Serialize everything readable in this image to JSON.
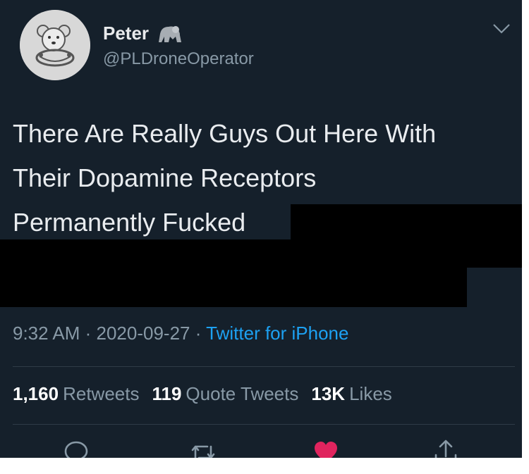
{
  "author": {
    "name": "Peter",
    "handle": "@PLDroneOperator",
    "avatar_icon": "teddy-bear-avatar",
    "badge_icon": "gorilla-icon"
  },
  "tweet": {
    "lines": [
      "There Are Really Guys Out Here With",
      "Their Dopamine Receptors",
      "Permanently Fucked"
    ]
  },
  "meta": {
    "time": "9:32 AM",
    "date": "2020-09-27",
    "separator": " · ",
    "source": "Twitter for iPhone"
  },
  "stats": {
    "retweets_count": "1,160",
    "retweets_label": "Retweets",
    "quotes_count": "119",
    "quotes_label": "Quote Tweets",
    "likes_count": "13K",
    "likes_label": "Likes"
  },
  "actions": [
    "reply-icon",
    "retweet-icon",
    "like-icon",
    "share-icon"
  ],
  "colors": {
    "background": "#15202b",
    "text": "#e9ecef",
    "secondary": "#8899a6",
    "link": "#1da1f2",
    "like": "#e0245e"
  }
}
